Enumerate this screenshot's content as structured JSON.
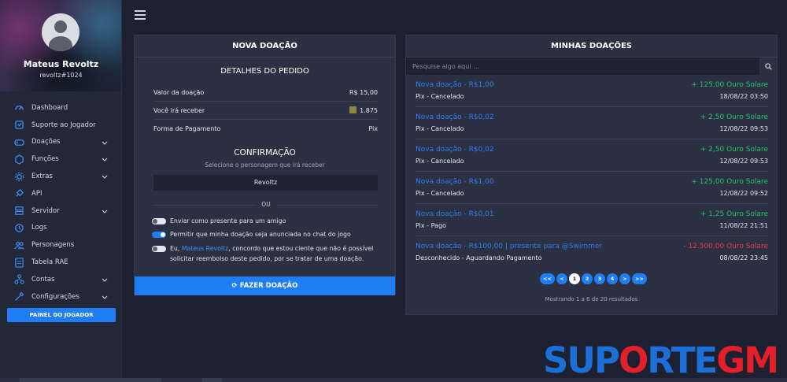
{
  "profile": {
    "name": "Mateus Revoltz",
    "tag": "revoltz#1024"
  },
  "nav": [
    {
      "label": "Dashboard",
      "icon": "speedometer-icon",
      "expandable": false
    },
    {
      "label": "Suporte ao Jogador",
      "icon": "support-icon",
      "expandable": false
    },
    {
      "label": "Doações",
      "icon": "gamepad-icon",
      "expandable": true
    },
    {
      "label": "Funções",
      "icon": "cube-icon",
      "expandable": true
    },
    {
      "label": "Extras",
      "icon": "gear-icon",
      "expandable": true
    },
    {
      "label": "API",
      "icon": "plug-icon",
      "expandable": false
    },
    {
      "label": "Servidor",
      "icon": "server-icon",
      "expandable": true
    },
    {
      "label": "Logs",
      "icon": "history-icon",
      "expandable": false
    },
    {
      "label": "Personagens",
      "icon": "users-icon",
      "expandable": false
    },
    {
      "label": "Tabela RAE",
      "icon": "table-icon",
      "expandable": false
    },
    {
      "label": "Contas",
      "icon": "network-icon",
      "expandable": true
    },
    {
      "label": "Configurações",
      "icon": "tools-icon",
      "expandable": true
    }
  ],
  "player_button": "PAINEL DO JOGADOR",
  "new_donation": {
    "title": "NOVA DOAÇÃO",
    "details_title": "DETALHES DO PEDIDO",
    "rows": [
      {
        "label": "Valor da doação",
        "value": "R$ 15,00"
      },
      {
        "label": "Você irá receber",
        "value": "1.875"
      },
      {
        "label": "Forma de Pagamento",
        "value": "Pix"
      }
    ],
    "confirm_title": "CONFIRMAÇÃO",
    "confirm_sub": "Selecione o personagem que irá receber",
    "character": "Revoltz",
    "or": "OU",
    "options": {
      "gift": "Enviar como presente para um amigo",
      "announce": "Permitir que minha doação seja anunciada no chat do jogo",
      "terms_prefix": "Eu, ",
      "terms_name": "Mateus Revoltz",
      "terms_suffix": ", concordo que estou ciente que não é possível solicitar reembolso deste pedido, por se tratar de uma doação."
    },
    "submit": "FAZER DOAÇÃO"
  },
  "my_donations": {
    "title": "MINHAS DOAÇÕES",
    "search_placeholder": "Pesquise algo aqui ...",
    "items": [
      {
        "title": "Nova doação - R$1,00",
        "status": "Pix - Cancelado",
        "amount": "+ 125,00 Ouro Solare",
        "date": "18/08/22 03:50",
        "negative": false
      },
      {
        "title": "Nova doação - R$0,02",
        "status": "Pix - Cancelado",
        "amount": "+ 2,50 Ouro Solare",
        "date": "12/08/22 09:53",
        "negative": false
      },
      {
        "title": "Nova doação - R$0,02",
        "status": "Pix - Cancelado",
        "amount": "+ 2,50 Ouro Solare",
        "date": "12/08/22 09:53",
        "negative": false
      },
      {
        "title": "Nova doação - R$1,00",
        "status": "Pix - Cancelado",
        "amount": "+ 125,00 Ouro Solare",
        "date": "12/08/22 09:52",
        "negative": false
      },
      {
        "title": "Nova doação - R$0,01",
        "status": "Pix - Pago",
        "amount": "+ 1,25 Ouro Solare",
        "date": "11/08/22 21:51",
        "negative": false
      },
      {
        "title": "Nova doação - R$100,00 | presente para @Swimmer",
        "status": "Desconhecido - Aguardando Pagamento",
        "amount": "- 12.500,00 Ouro Solare",
        "date": "08/08/22 23:45",
        "negative": true
      }
    ],
    "pager": [
      "<<",
      "<",
      "1",
      "2",
      "3",
      "4",
      ">",
      ">>"
    ],
    "current_page": "1",
    "results": "Mostrando 1 a 6 de 20 resultados"
  },
  "logo": {
    "part1": "SUP",
    "part2": "O",
    "part3": "RTE",
    "part4": "GM"
  },
  "colors": {
    "accent": "#1f7ef5",
    "positive": "#27c26a",
    "negative": "#ec3b4d",
    "link": "#2f7ff0"
  }
}
